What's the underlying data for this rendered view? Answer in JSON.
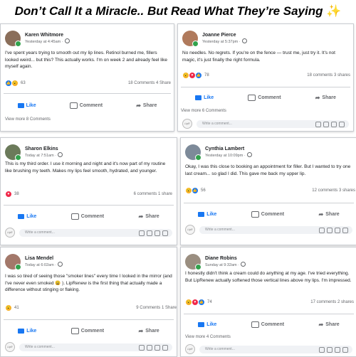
{
  "headline": "Don’t Call It a Miracle.. But Read What They’re Saying",
  "headline_sparkle": "✨",
  "ui": {
    "like_label": "Like",
    "comment_label": "Comment",
    "share_label": "Share",
    "write_comment_placeholder": "Write a comment..."
  },
  "posts": [
    {
      "name": "Karen Whitmore",
      "time": "Yesterday at 4:45am ·",
      "text": "I've spent years trying to smooth out my lip lines. Retinol burned me, fillers looked weird... but this? This actually works. I'm on week 2 and already feel like myself again.",
      "reactions": "63",
      "stats": "18 Comments 4 Share",
      "view_more": "View more 8 Comments",
      "avatar_color": "#8a6e5a"
    },
    {
      "name": "Joanne Pierce",
      "time": "Yesterday at 5:37pm ·",
      "text": "No needles. No regrets. If you're on the fence — trust me, just try it. It's not magic, it's just finally the right formula.",
      "reactions": "78",
      "stats": "18 comments 3 shares",
      "view_more": "View more 6 Comments",
      "avatar_color": "#b07a5c"
    },
    {
      "name": "Sharon Elkins",
      "time": "Today at 7:51am ·",
      "text": "This is my third order. I use it morning and night and it's now part of my routine like brushing my teeth. Makes my lips feel smooth, hydrated, and younger.",
      "reactions": "38",
      "stats": "6 comments 1 share",
      "avatar_color": "#6b7a5a"
    },
    {
      "name": "Cynthia Lambert",
      "time": "Yesterday at 10:09pm ·",
      "text": "Okay, I was this close to booking an appointment for filler. But I wanted to try one last cream... so glad I did. This gave me back my upper lip.",
      "reactions": "56",
      "stats": "12 comments 3 shares",
      "avatar_color": "#7d8a99"
    },
    {
      "name": "Lisa Mendel",
      "time": "Today at 6:02am ·",
      "text": "I was so tired of seeing those \"smoker lines\" every time I looked in the mirror (and I've never even smoked 😩 ). LipRenew is the first thing that actually made a difference without stinging or flaking.",
      "reactions": "41",
      "stats": "9 Comments 1 Share",
      "avatar_color": "#a3786a"
    },
    {
      "name": "Diane Robins",
      "time": "Sunday at 9:32am ·",
      "text": "I honestly didn't think a cream could do anything at my age. I've tried everything. But LipRenew actually softened those vertical lines above my lips. I'm impressed.",
      "reactions": "74",
      "stats": "17 comments 2 shares",
      "view_more": "View more 4 Comments",
      "avatar_color": "#9a8e80"
    }
  ]
}
